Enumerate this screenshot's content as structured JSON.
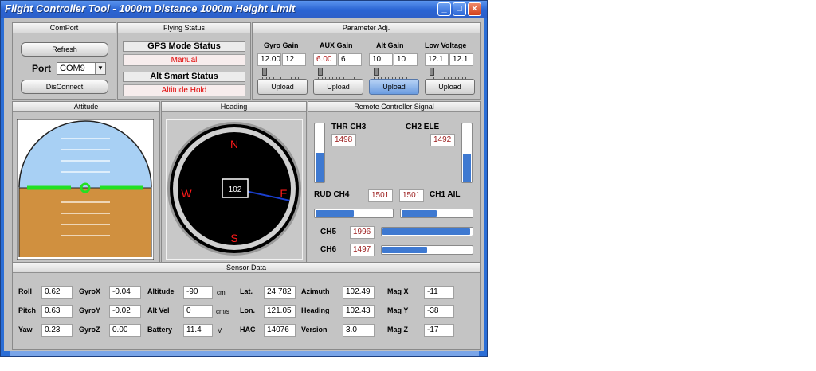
{
  "window": {
    "title": "Flight Controller Tool - 1000m Distance 1000m Height Limit"
  },
  "comport": {
    "title": "ComPort",
    "refresh_label": "Refresh",
    "port_label": "Port",
    "port_value": "COM9",
    "disconnect_label": "DisConnect"
  },
  "flying_status": {
    "title": "Flying Status",
    "gps_head": "GPS Mode Status",
    "gps_value": "Manual",
    "alt_head": "Alt Smart Status",
    "alt_value": "Altitude Hold"
  },
  "param": {
    "title": "Parameter Adj.",
    "upload_label": "Upload",
    "gains": [
      {
        "label": "Gyro Gain",
        "v1": "12.00",
        "v2": "12"
      },
      {
        "label": "AUX Gain",
        "v1": "6.00",
        "v2": "6"
      },
      {
        "label": "Alt Gain",
        "v1": "10",
        "v2": "10"
      },
      {
        "label": "Low Voltage",
        "v1": "12.1",
        "v2": "12.1"
      }
    ]
  },
  "attitude": {
    "title": "Attitude"
  },
  "heading": {
    "title": "Heading",
    "value": "102",
    "n": "N",
    "e": "E",
    "s": "S",
    "w": "W"
  },
  "rc": {
    "title": "Remote Controller Signal",
    "thr_label": "THR CH3",
    "thr_value": "1498",
    "thr_level": 0.5,
    "ele_label": "CH2 ELE",
    "ele_value": "1492",
    "ele_level": 0.49,
    "rud_label": "RUD CH4",
    "rud_value": "1501",
    "rud_level": 0.5,
    "ail_label": "CH1 AIL",
    "ail_value": "1501",
    "ail_level": 0.5,
    "ch5_label": "CH5",
    "ch5_value": "1996",
    "ch5_level": 0.98,
    "ch6_label": "CH6",
    "ch6_value": "1497",
    "ch6_level": 0.5
  },
  "sensor": {
    "title": "Sensor Data",
    "roll": {
      "label": "Roll",
      "value": "0.62"
    },
    "pitch": {
      "label": "Pitch",
      "value": "0.63"
    },
    "yaw": {
      "label": "Yaw",
      "value": "0.23"
    },
    "gyrox": {
      "label": "GyroX",
      "value": "-0.04"
    },
    "gyroy": {
      "label": "GyroY",
      "value": "-0.02"
    },
    "gyroz": {
      "label": "GyroZ",
      "value": "0.00"
    },
    "altitude": {
      "label": "Altitude",
      "value": "-90",
      "unit": "cm"
    },
    "altvel": {
      "label": "Alt Vel",
      "value": "0",
      "unit": "cm/s"
    },
    "battery": {
      "label": "Battery",
      "value": "11.4",
      "unit": "V"
    },
    "lat": {
      "label": "Lat.",
      "value": "24.782"
    },
    "lon": {
      "label": "Lon.",
      "value": "121.05"
    },
    "hac": {
      "label": "HAC",
      "value": "14076"
    },
    "azimuth": {
      "label": "Azimuth",
      "value": "102.49"
    },
    "headingv": {
      "label": "Heading",
      "value": "102.43"
    },
    "version": {
      "label": "Version",
      "value": "3.0"
    },
    "magx": {
      "label": "Mag X",
      "value": "-11"
    },
    "magy": {
      "label": "Mag Y",
      "value": "-38"
    },
    "magz": {
      "label": "Mag Z",
      "value": "-17"
    }
  }
}
